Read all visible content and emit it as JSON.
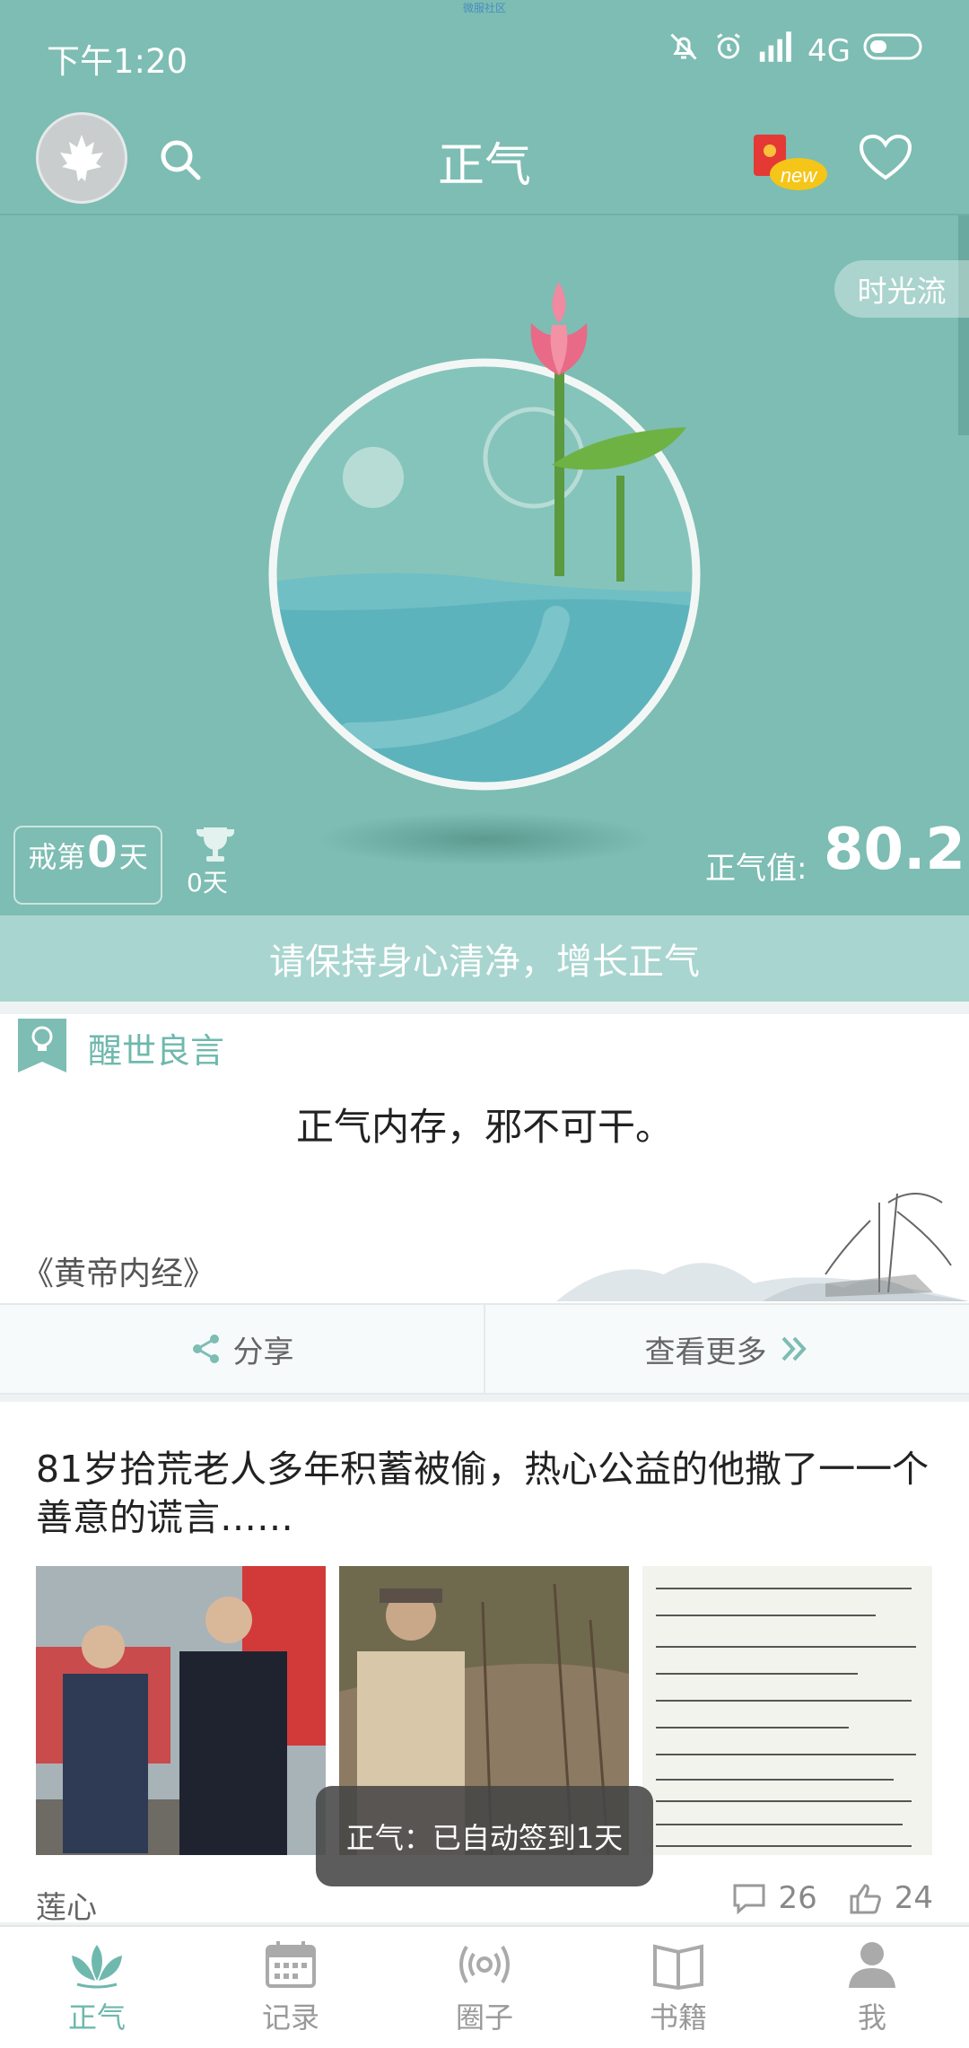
{
  "status_bar": {
    "time": "下午1:20",
    "network": "4G",
    "top_caption": "微服社区"
  },
  "navbar": {
    "title": "正气",
    "new_badge": "new"
  },
  "hero": {
    "timeflow_label": "时光流",
    "streak_prefix": "戒第",
    "streak_days": "0",
    "streak_suffix": "天",
    "best_days": "0天",
    "zhengqi_label": "正气值:",
    "zhengqi_value": "80.2",
    "banner": "请保持身心清净，增长正气"
  },
  "quote_card": {
    "section_label": "醒世良言",
    "quote": "正气内存，邪不可干。",
    "source": "《黄帝内经》",
    "share_label": "分享",
    "more_label": "查看更多"
  },
  "article": {
    "headline": "81岁拾荒老人多年积蓄被偷，热心公益的他撒了一一个善意的谎言……",
    "author": "莲心",
    "comments": "26",
    "likes": "24"
  },
  "toast": "正气：已自动签到1天",
  "tabbar": {
    "tabs": [
      {
        "label": "正气",
        "active": true
      },
      {
        "label": "记录",
        "active": false
      },
      {
        "label": "圈子",
        "active": false
      },
      {
        "label": "书籍",
        "active": false
      },
      {
        "label": "我",
        "active": false
      }
    ]
  },
  "colors": {
    "teal": "#7dbdb3",
    "accent": "#6fb8ad",
    "banner": "#a8d5cf"
  }
}
